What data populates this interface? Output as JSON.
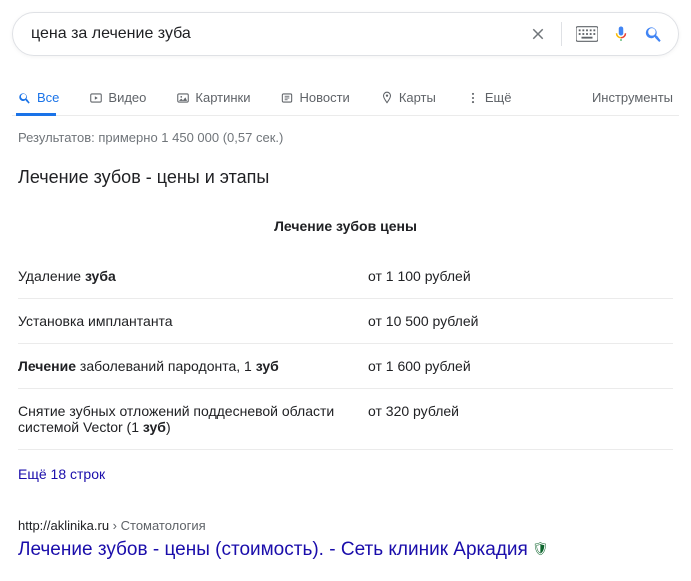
{
  "search": {
    "query": "цена за лечение зуба"
  },
  "tabs": {
    "all": "Все",
    "video": "Видео",
    "images": "Картинки",
    "news": "Новости",
    "maps": "Карты",
    "more": "Ещё",
    "tools": "Инструменты"
  },
  "stats": "Результатов: примерно 1 450 000 (0,57 сек.)",
  "snippet": {
    "title": "Лечение зубов - цены и этапы",
    "table_title": "Лечение зубов цены",
    "rows": [
      {
        "name_html": "Удаление <b>зуба</b>",
        "price": "от 1 100 рублей"
      },
      {
        "name_html": "Установка имплантанта",
        "price": "от 10 500 рублей"
      },
      {
        "name_html": "<b>Лечение</b> заболеваний пародонта, 1 <b>зуб</b>",
        "price": "от 1 600 рублей"
      },
      {
        "name_html": "Снятие зубных отложений поддесневой области системой Vector (1 <b>зуб</b>)",
        "price": "от 320 рублей"
      }
    ],
    "more": "Ещё 18 строк"
  },
  "result": {
    "url": "http://aklinika.ru",
    "crumb": "Стоматология",
    "title": "Лечение зубов - цены (стоимость). - Сеть клиник Аркадия"
  }
}
